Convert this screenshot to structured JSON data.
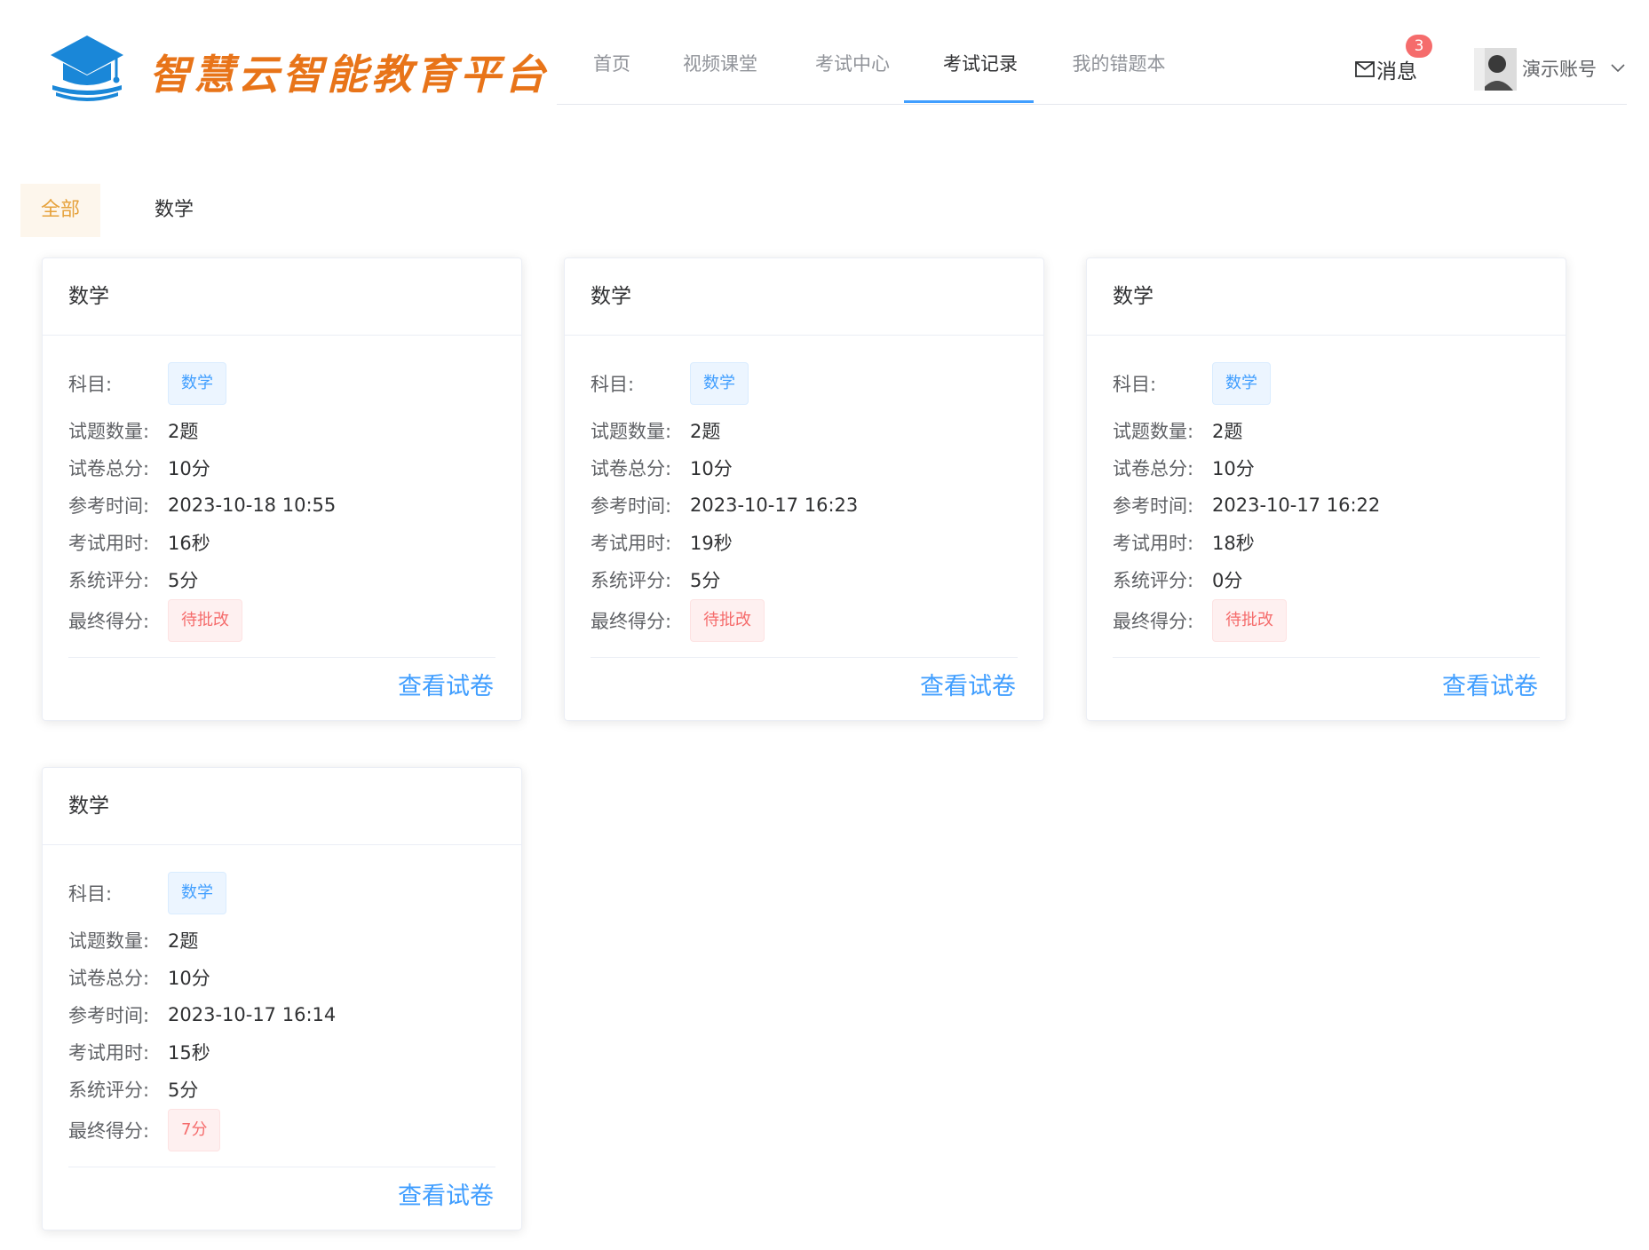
{
  "brand": {
    "name": "智慧云智能教育平台"
  },
  "nav": [
    "首页",
    "视频课堂",
    "考试中心",
    "考试记录",
    "我的错题本"
  ],
  "header": {
    "messages_label": "消息",
    "messages_count": "3",
    "username": "演示账号"
  },
  "filters": [
    "全部",
    "数学"
  ],
  "labels": {
    "subject": "科目:",
    "question_count": "试题数量:",
    "total_score": "试卷总分:",
    "exam_time": "参考时间:",
    "duration": "考试用时:",
    "system_score": "系统评分:",
    "final_score": "最终得分:",
    "view": "查看试卷"
  },
  "cards": [
    {
      "title": "数学",
      "subject": "数学",
      "question_count": "2题",
      "total_score": "10分",
      "exam_time": "2023-10-18 10:55",
      "duration": "16秒",
      "system_score": "5分",
      "final_score": "待批改"
    },
    {
      "title": "数学",
      "subject": "数学",
      "question_count": "2题",
      "total_score": "10分",
      "exam_time": "2023-10-17 16:23",
      "duration": "19秒",
      "system_score": "5分",
      "final_score": "待批改"
    },
    {
      "title": "数学",
      "subject": "数学",
      "question_count": "2题",
      "total_score": "10分",
      "exam_time": "2023-10-17 16:22",
      "duration": "18秒",
      "system_score": "0分",
      "final_score": "待批改"
    },
    {
      "title": "数学",
      "subject": "数学",
      "question_count": "2题",
      "total_score": "10分",
      "exam_time": "2023-10-17 16:14",
      "duration": "15秒",
      "system_score": "5分",
      "final_score": "7分"
    }
  ],
  "colors": {
    "accent": "#409eff",
    "brand": "#e87419",
    "danger": "#f56c6c",
    "warning": "#e6a23c"
  }
}
